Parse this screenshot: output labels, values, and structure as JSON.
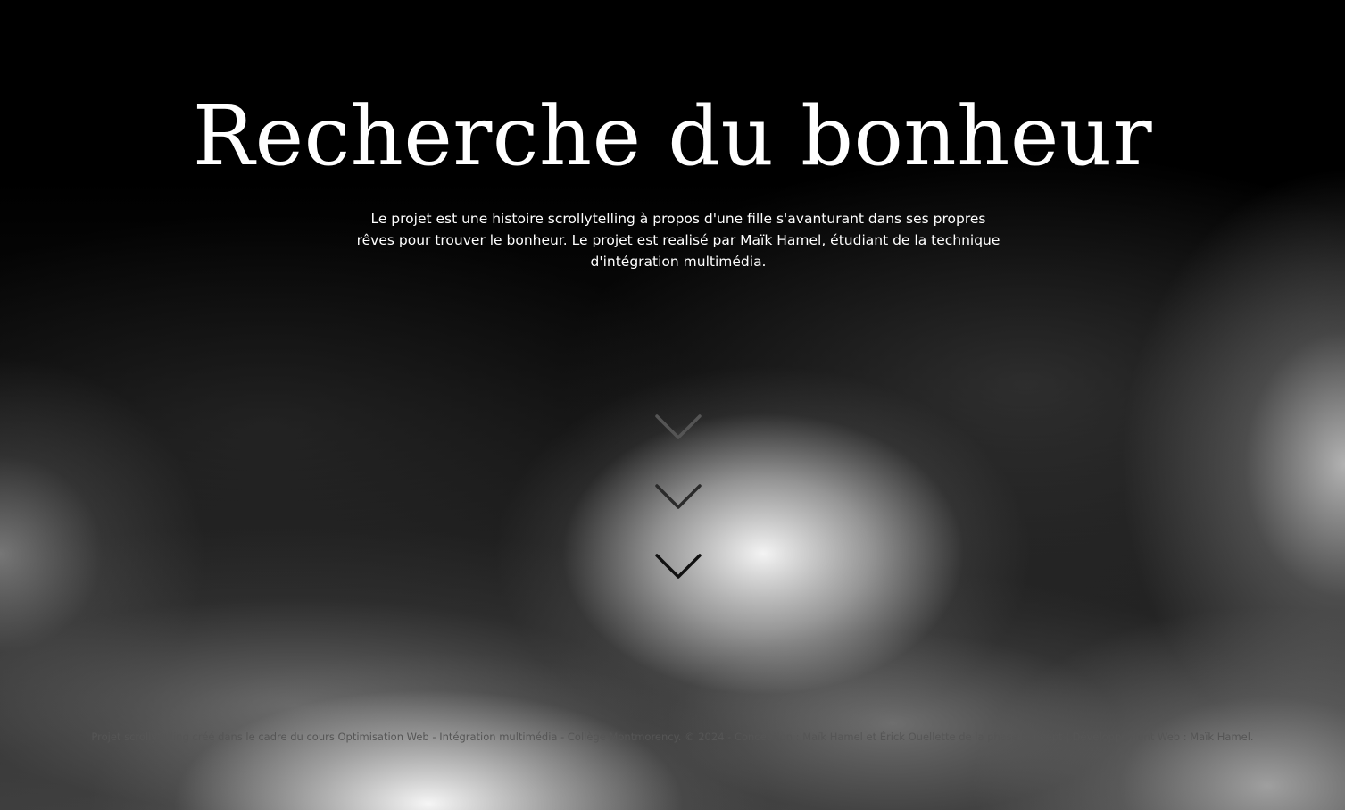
{
  "hero": {
    "title": "Recherche du bonheur",
    "intro": "Le projet est une histoire scrollytelling à propos d'une fille s'avanturant dans ses propres rêves pour trouver le bonheur. Le projet est realisé par Maïk Hamel, étudiant de la technique d'intégration multimédia."
  },
  "scroll_hint": {
    "icon": "chevron-down-icon",
    "count": 3,
    "colors": [
      "#555555",
      "#2a2a2a",
      "#111111"
    ]
  },
  "footer": {
    "credits": "Projet scrollytelling créé dans le cadre du cours Optimisation Web - Intégration multimédia - Collège Montmorency. © 2024 - Conception : Maïk Hamel et Érick Ouellette de la phase concept | Développement Web : Maïk Hamel."
  },
  "colors": {
    "background": "#000000",
    "title_text": "#ffffff",
    "footer_text": "#555555"
  }
}
